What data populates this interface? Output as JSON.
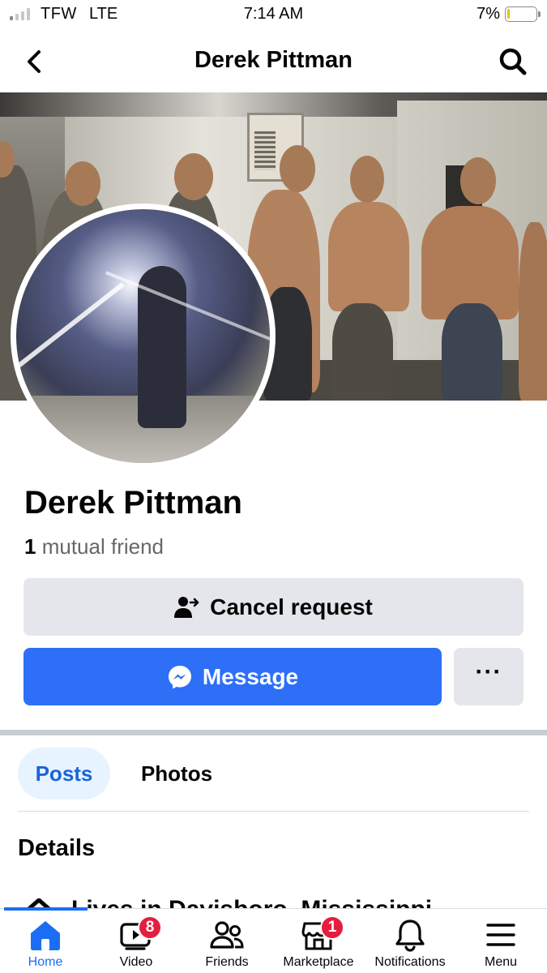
{
  "status_bar": {
    "carrier": "TFW",
    "network": "LTE",
    "time": "7:14 AM",
    "battery_percent": "7%",
    "battery_level": 0.07,
    "signal_bars_filled": 1,
    "signal_bars_total": 4
  },
  "header": {
    "title": "Derek Pittman",
    "back_icon": "chevron-left-icon",
    "search_icon": "search-icon"
  },
  "profile": {
    "name": "Derek Pittman",
    "mutual_count": "1",
    "mutual_label": "mutual friend"
  },
  "actions": {
    "cancel_request": "Cancel request",
    "cancel_icon": "person-arrow-icon",
    "message": "Message",
    "message_icon": "messenger-icon",
    "more": "···"
  },
  "tabs": [
    {
      "label": "Posts",
      "active": true
    },
    {
      "label": "Photos",
      "active": false
    }
  ],
  "details": {
    "heading": "Details",
    "lives_in": "Lives in Davisboro, Mississippi"
  },
  "bottom_nav": [
    {
      "label": "Home",
      "icon": "home-icon",
      "active": true
    },
    {
      "label": "Video",
      "icon": "video-icon",
      "badge": "8"
    },
    {
      "label": "Friends",
      "icon": "friends-icon"
    },
    {
      "label": "Marketplace",
      "icon": "marketplace-icon",
      "badge": "1"
    },
    {
      "label": "Notifications",
      "icon": "bell-icon"
    },
    {
      "label": "Menu",
      "icon": "menu-icon"
    }
  ],
  "colors": {
    "accent": "#1b6ef3",
    "message_button": "#2d6ff7",
    "secondary_button": "#e4e6eb",
    "active_tab_bg": "#e7f3ff",
    "badge": "#e41e3f",
    "battery_low": "#e6c200"
  }
}
